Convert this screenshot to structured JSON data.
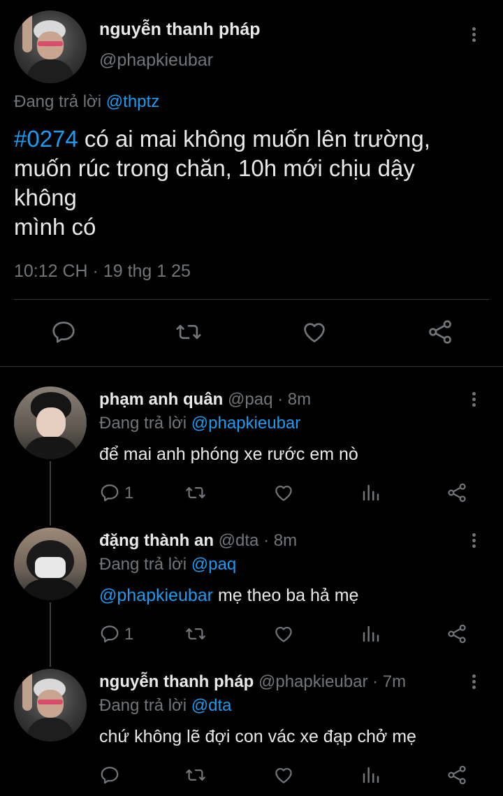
{
  "main_tweet": {
    "author_name": "nguyễn thanh pháp",
    "author_handle": "@phapkieubar",
    "reply_prefix": "Đang trả lời",
    "reply_to": "@thptz",
    "hashtag": "#0274",
    "text_line1": " có ai mai không muốn lên trường,",
    "text_line2": "muốn rúc trong chăn, 10h mới chịu dậy",
    "text_line3": "không",
    "text_line4": "mình có",
    "timestamp": "10:12 CH · 19 thg 1 25"
  },
  "replies": [
    {
      "author_name": "phạm anh quân",
      "meta": "@paq · 8m",
      "reply_prefix": "Đang trả lời",
      "reply_to": "@phapkieubar",
      "mention": "",
      "text": "để mai anh phóng xe rước em nò",
      "reply_count": "1"
    },
    {
      "author_name": "đặng thành an",
      "meta": "@dta · 8m",
      "reply_prefix": "Đang trả lời",
      "reply_to": "@paq",
      "mention": "@phapkieubar",
      "text": " mẹ theo ba hả mẹ",
      "reply_count": "1"
    },
    {
      "author_name": "nguyễn thanh pháp",
      "meta": "@phapkieubar · 7m",
      "reply_prefix": "Đang trả lời",
      "reply_to": "@dta",
      "mention": "",
      "text": "chứ không lẽ đợi con vác xe đạp chở mẹ",
      "reply_count": ""
    }
  ],
  "icons": {
    "reply": "reply-icon",
    "retweet": "retweet-icon",
    "like": "like-icon",
    "views": "views-icon",
    "share": "share-icon",
    "more": "more-icon"
  },
  "colors": {
    "background": "#000000",
    "text": "#e7e9ea",
    "muted": "#71767b",
    "accent": "#1d9bf0"
  }
}
